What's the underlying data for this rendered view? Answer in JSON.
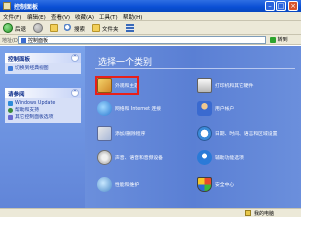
{
  "window": {
    "title": "控制面板"
  },
  "menubar": {
    "items": [
      "文件(F)",
      "编辑(E)",
      "查看(V)",
      "收藏(A)",
      "工具(T)",
      "帮助(H)"
    ]
  },
  "toolbar": {
    "back": "后退",
    "search": "搜索",
    "folders": "文件夹"
  },
  "addressbar": {
    "label": "地址(D)",
    "value": "控制面板",
    "go": "转到"
  },
  "sidebar": {
    "panel1": {
      "title": "控制面板",
      "links": [
        "切换到经典视图"
      ]
    },
    "panel2": {
      "title": "请参阅",
      "links": [
        "Windows Update",
        "帮助和支持",
        "其它控制面板选项"
      ]
    }
  },
  "main": {
    "heading": "选择一个类别",
    "categories": [
      {
        "label": "外观和主题",
        "icon": "appearance-icon"
      },
      {
        "label": "网络和 Internet 连接",
        "icon": "network-icon"
      },
      {
        "label": "添加/删除程序",
        "icon": "add-remove-programs-icon"
      },
      {
        "label": "声音、语音和音频设备",
        "icon": "sound-icon"
      },
      {
        "label": "性能和维护",
        "icon": "performance-icon"
      },
      {
        "label": "打印机和其它硬件",
        "icon": "printer-icon"
      },
      {
        "label": "用户帐户",
        "icon": "user-accounts-icon"
      },
      {
        "label": "日期、时间、语言和区域设置",
        "icon": "date-time-icon"
      },
      {
        "label": "辅助功能选项",
        "icon": "accessibility-icon"
      },
      {
        "label": "安全中心",
        "icon": "security-center-icon"
      }
    ]
  },
  "statusbar": {
    "text": "我的电脑"
  },
  "colors": {
    "titlebar": "#0a4fd4",
    "content": "#6b8fdc",
    "highlight": "#e8201a"
  }
}
